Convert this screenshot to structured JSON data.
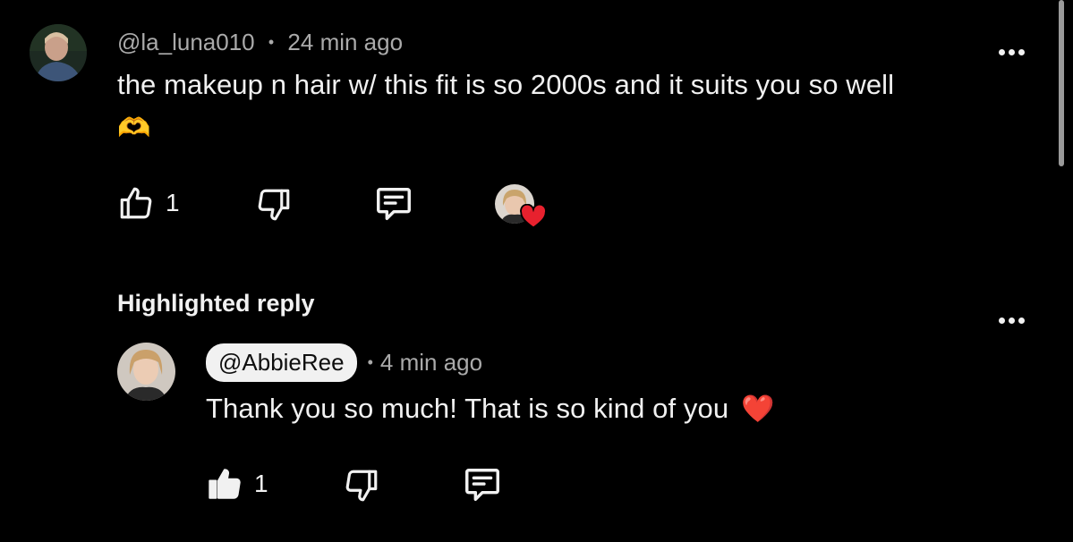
{
  "comment": {
    "author": "@la_luna010",
    "separator": "•",
    "time": "24 min ago",
    "text": "the makeup n hair w/ this fit is so 2000s and it suits you so well",
    "emoji": "🫶",
    "like_count": "1",
    "creator_heart": true
  },
  "highlighted_label": "Highlighted reply",
  "reply": {
    "author": "@AbbieRee",
    "separator": "•",
    "time": "4 min ago",
    "text": "Thank you so much! That is so kind of you",
    "emoji": "❤️",
    "like_count": "1",
    "liked": true
  },
  "icons": {
    "like": "thumbs-up-icon",
    "dislike": "thumbs-down-icon",
    "reply": "comment-icon",
    "more": "more-options-icon",
    "heart": "heart-icon"
  },
  "colors": {
    "background": "#000000",
    "text": "#f1f1f1",
    "meta": "#aaaaaa",
    "heart": "#e8212e"
  }
}
